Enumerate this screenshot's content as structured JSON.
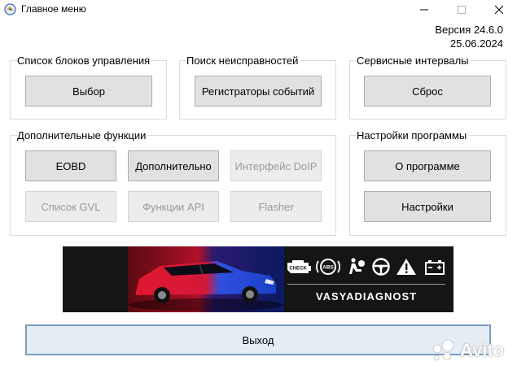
{
  "window": {
    "title": "Главное меню",
    "icon": "app-logo-icon",
    "controls": [
      "minimize-icon",
      "maximize-icon",
      "close-icon"
    ]
  },
  "version": {
    "line1": "Версия 24.6.0",
    "line2": "25.06.2024"
  },
  "groups": {
    "control_units": {
      "label": "Список блоков управления",
      "button": "Выбор"
    },
    "fault_search": {
      "label": "Поиск неисправностей",
      "button": "Регистраторы событий"
    },
    "service": {
      "label": "Сервисные интервалы",
      "button": "Сброс"
    },
    "extra": {
      "label": "Дополнительные функции",
      "buttons": {
        "eobd": "EOBD",
        "additional": "Дополнительно",
        "doip": "Интерфейс DoIP",
        "gvl": "Список GVL",
        "api": "Функции API",
        "flasher": "Flasher"
      }
    },
    "settings": {
      "label": "Настройки программы",
      "about": "О программе",
      "settings": "Настройки"
    }
  },
  "banner": {
    "brand": "VASYADIAGNOST",
    "icons": [
      "check-engine-icon",
      "abs-icon",
      "airbag-icon",
      "steering-wheel-icon",
      "warning-triangle-icon",
      "battery-icon"
    ],
    "check_label": "CHECK",
    "abs_label": "ABS"
  },
  "exit_button": "Выход",
  "watermark": {
    "text": "Avito"
  },
  "colors": {
    "button_bg": "#e1e1e1",
    "button_border": "#adadad",
    "disabled_text": "#9a9a9a",
    "exit_border": "#7a9cc2",
    "banner_bg": "#151515",
    "car_red": "#c8102e",
    "car_blue": "#1a4fd6"
  }
}
